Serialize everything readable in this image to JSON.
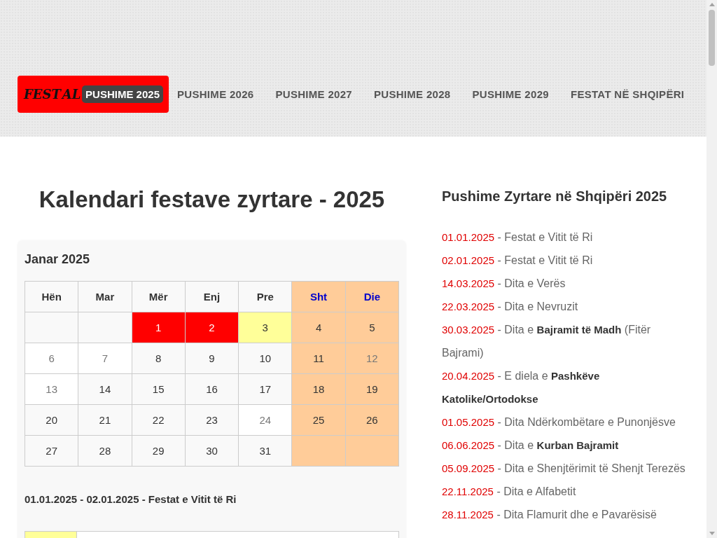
{
  "header": {
    "logo_left": "FEST",
    "logo_right": "AL",
    "nav": [
      {
        "label": "PUSHIME 2025",
        "selected": true
      },
      {
        "label": "PUSHIME 2026",
        "selected": false
      },
      {
        "label": "PUSHIME 2027",
        "selected": false
      },
      {
        "label": "PUSHIME 2028",
        "selected": false
      },
      {
        "label": "PUSHIME 2029",
        "selected": false
      },
      {
        "label": "FESTAT NË SHQIPËRI",
        "selected": false
      }
    ]
  },
  "main": {
    "title": "Kalendari festave zyrtare - 2025",
    "month": {
      "title": "Janar 2025",
      "weekdays": [
        {
          "label": "Hën",
          "weekend": false
        },
        {
          "label": "Mar",
          "weekend": false
        },
        {
          "label": "Mër",
          "weekend": false
        },
        {
          "label": "Enj",
          "weekend": false
        },
        {
          "label": "Pre",
          "weekend": false
        },
        {
          "label": "Sht",
          "weekend": true
        },
        {
          "label": "Die",
          "weekend": true
        }
      ],
      "weeks": [
        [
          {
            "kind": "empty"
          },
          {
            "kind": "empty"
          },
          {
            "day": "1",
            "kind": "holiday",
            "muted": false
          },
          {
            "day": "2",
            "kind": "holiday",
            "muted": false
          },
          {
            "day": "3",
            "kind": "bridge",
            "muted": false
          },
          {
            "day": "4",
            "kind": "weekend",
            "muted": false
          },
          {
            "day": "5",
            "kind": "weekend",
            "muted": false
          }
        ],
        [
          {
            "day": "6",
            "kind": "normal",
            "muted": true
          },
          {
            "day": "7",
            "kind": "normal",
            "muted": true
          },
          {
            "day": "8",
            "kind": "normal",
            "muted": false
          },
          {
            "day": "9",
            "kind": "normal",
            "muted": false
          },
          {
            "day": "10",
            "kind": "normal",
            "muted": false
          },
          {
            "day": "11",
            "kind": "weekend",
            "muted": false
          },
          {
            "day": "12",
            "kind": "weekend",
            "muted": true
          }
        ],
        [
          {
            "day": "13",
            "kind": "normal",
            "muted": true
          },
          {
            "day": "14",
            "kind": "normal",
            "muted": false
          },
          {
            "day": "15",
            "kind": "normal",
            "muted": false
          },
          {
            "day": "16",
            "kind": "normal",
            "muted": false
          },
          {
            "day": "17",
            "kind": "normal",
            "muted": false
          },
          {
            "day": "18",
            "kind": "weekend",
            "muted": false
          },
          {
            "day": "19",
            "kind": "weekend",
            "muted": false
          }
        ],
        [
          {
            "day": "20",
            "kind": "normal",
            "muted": false
          },
          {
            "day": "21",
            "kind": "normal",
            "muted": false
          },
          {
            "day": "22",
            "kind": "normal",
            "muted": false
          },
          {
            "day": "23",
            "kind": "normal",
            "muted": false
          },
          {
            "day": "24",
            "kind": "normal",
            "muted": true
          },
          {
            "day": "25",
            "kind": "weekend",
            "muted": false
          },
          {
            "day": "26",
            "kind": "weekend",
            "muted": false
          }
        ],
        [
          {
            "day": "27",
            "kind": "normal",
            "muted": false
          },
          {
            "day": "28",
            "kind": "normal",
            "muted": false
          },
          {
            "day": "29",
            "kind": "normal",
            "muted": false
          },
          {
            "day": "30",
            "kind": "normal",
            "muted": false
          },
          {
            "day": "31",
            "kind": "normal",
            "muted": false
          },
          {
            "kind": "weekend"
          },
          {
            "kind": "weekend"
          }
        ]
      ],
      "holidays": [
        "01.01.2025 - 02.01.2025 - Festat e Vitit të Ri"
      ],
      "legend": [
        {
          "kind": "bridge"
        }
      ]
    }
  },
  "sidebar": {
    "title": "Pushime Zyrtare në Shqipëri 2025",
    "items": [
      {
        "date": "01.01.2025",
        "text": "- Festat e Vitit të Ri"
      },
      {
        "date": "02.01.2025",
        "text": "- Festat e Vitit të Ri"
      },
      {
        "date": "14.03.2025",
        "text": "- Dita e Verës"
      },
      {
        "date": "22.03.2025",
        "text": "- Dita e Nevruzit"
      },
      {
        "date": "30.03.2025",
        "text": "- Dita e **Bajramit të Madh** (Fitër Bajrami)"
      },
      {
        "date": "20.04.2025",
        "text": "- E diela e **Pashkëve Katolike/Ortodokse**"
      },
      {
        "date": "01.05.2025",
        "text": "- Dita Ndërkombëtare e Punonjësve"
      },
      {
        "date": "06.06.2025",
        "text": "- Dita e **Kurban Bajramit**"
      },
      {
        "date": "05.09.2025",
        "text": "- Dita e Shenjtërimit të Shenjt Terezës"
      },
      {
        "date": "22.11.2025",
        "text": "- Dita e Alfabetit"
      },
      {
        "date": "28.11.2025",
        "text": "- Dita Flamurit dhe e Pavarësisë"
      }
    ]
  }
}
